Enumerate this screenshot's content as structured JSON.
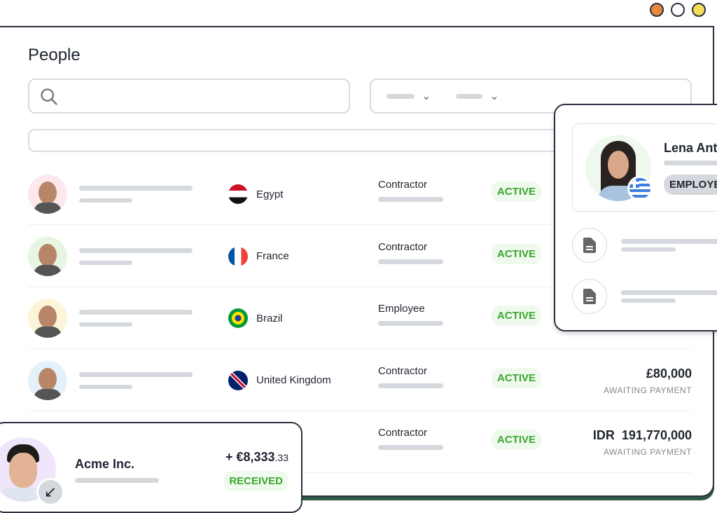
{
  "window_controls": [
    {
      "name": "close",
      "color": "#e8883a"
    },
    {
      "name": "minimize",
      "color": "#ffffff"
    },
    {
      "name": "maximize",
      "color": "#f5dc5a"
    }
  ],
  "page": {
    "title": "People"
  },
  "search": {
    "placeholder": "",
    "icon": "search-icon"
  },
  "rows": [
    {
      "country": "Egypt",
      "role": "Contractor",
      "status": "ACTIVE",
      "avatar_bg": "#fde8ec"
    },
    {
      "country": "France",
      "role": "Contractor",
      "status": "ACTIVE",
      "avatar_bg": "#e6f6e2"
    },
    {
      "country": "Brazil",
      "role": "Employee",
      "status": "ACTIVE",
      "avatar_bg": "#fdf5da"
    },
    {
      "country": "United Kingdom",
      "role": "Contractor",
      "status": "ACTIVE",
      "amount": "£80,000",
      "amount_status": "AWAITING PAYMENT",
      "avatar_bg": "#e4f1fb"
    },
    {
      "country": "",
      "role": "Contractor",
      "status": "ACTIVE",
      "amount": "IDR  191,770,000",
      "amount_status": "AWAITING PAYMENT"
    }
  ],
  "profile_card": {
    "name": "Lena Ant",
    "badge": "EMPLOYE",
    "flag": "Greece"
  },
  "payment_card": {
    "company": "Acme Inc.",
    "amount_main": "+ €8,333",
    "amount_cents": ".33",
    "status": "RECEIVED",
    "icon": "arrow-down-left-icon"
  },
  "colors": {
    "active": "#3aa62e",
    "border": "#2a3040",
    "placeholder_bar": "#d5d9dd"
  }
}
